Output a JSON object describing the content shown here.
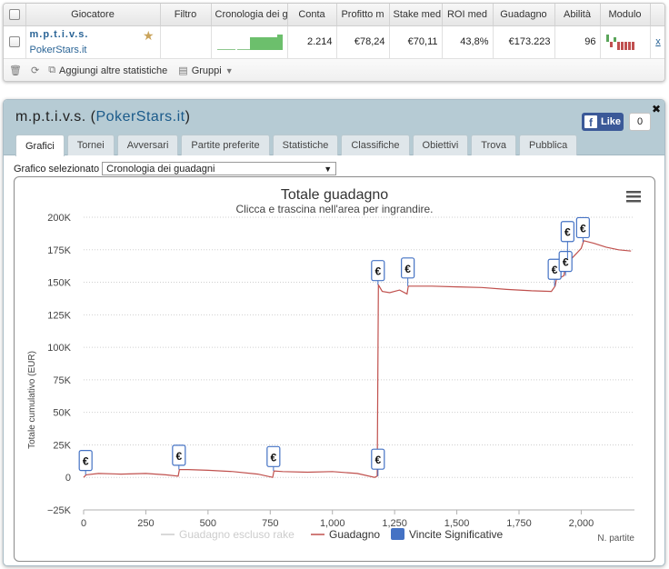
{
  "table": {
    "headers": [
      "Giocatore",
      "Filtro",
      "Cronologia dei g",
      "Conta",
      "Profitto m",
      "Stake med",
      "ROI med",
      "Guadagno",
      "Abilità",
      "Modulo"
    ],
    "row": {
      "player": "m.p.t.i.v.s.",
      "room": "PokerStars.it",
      "filter": "",
      "count": "2.214",
      "avg_profit": "€78,24",
      "avg_stake": "€70,11",
      "avg_roi": "43,8%",
      "winnings": "€173.223",
      "ability": "96",
      "remove": "x"
    },
    "toolbar": {
      "add_stats": "Aggiungi altre statistiche",
      "groups": "Gruppi"
    }
  },
  "panel": {
    "player": "m.p.t.i.v.s.",
    "site": "PokerStars.it",
    "like_label": "Like",
    "like_count": "0",
    "tabs": [
      "Grafici",
      "Tornei",
      "Avversari",
      "Partite preferite",
      "Statistiche",
      "Classifiche",
      "Obiettivi",
      "Trova",
      "Pubblica"
    ],
    "active_tab": "Grafici",
    "selector_label": "Grafico selezionato",
    "selected_chart": "Cronologia dei guadagni"
  },
  "chart_data": {
    "type": "line",
    "title": "Totale guadagno",
    "subtitle": "Clicca e trascina nell'area per ingrandire.",
    "xlabel": "N. partite",
    "ylabel": "Totale cumulativo (EUR)",
    "xlim": [
      0,
      2214
    ],
    "ylim": [
      -25000,
      200000
    ],
    "xticks": [
      0,
      250,
      500,
      750,
      1000,
      1250,
      1500,
      1750,
      2000
    ],
    "xtick_labels": [
      "0",
      "250",
      "500",
      "750",
      "1,000",
      "1,250",
      "1,500",
      "1,750",
      "2,000"
    ],
    "yticks": [
      -25000,
      0,
      25000,
      50000,
      75000,
      100000,
      125000,
      150000,
      175000,
      200000
    ],
    "ytick_labels": [
      "−25K",
      "0",
      "25K",
      "50K",
      "75K",
      "100K",
      "125K",
      "150K",
      "175K",
      "200K"
    ],
    "grid": "horizontal dotted",
    "legend_position": "bottom",
    "series": [
      {
        "name": "Guadagno escluso rake",
        "color": "#cccccc",
        "visible": false
      },
      {
        "name": "Guadagno",
        "color": "#c0504d",
        "x": [
          0,
          10,
          60,
          150,
          250,
          330,
          380,
          385,
          420,
          500,
          600,
          700,
          760,
          765,
          800,
          900,
          1000,
          1100,
          1170,
          1180,
          1185,
          1200,
          1230,
          1270,
          1300,
          1305,
          1400,
          1500,
          1600,
          1700,
          1800,
          1880,
          1895,
          1900,
          1930,
          1940,
          1960,
          1980,
          2000,
          2010,
          2050,
          2100,
          2150,
          2200
        ],
        "y": [
          0,
          2000,
          3000,
          2500,
          3000,
          2000,
          1000,
          6000,
          6000,
          5500,
          4500,
          2500,
          0,
          5000,
          4500,
          4000,
          4500,
          3000,
          0,
          1000,
          148000,
          143000,
          142000,
          144000,
          141000,
          147000,
          147000,
          146500,
          146000,
          144500,
          143500,
          143000,
          147000,
          152000,
          155000,
          165000,
          168000,
          172000,
          176000,
          182000,
          180000,
          177000,
          175000,
          174000
        ]
      },
      {
        "name": "Vincite Significative",
        "color": "#4472c4",
        "marker_label": "€",
        "points": [
          {
            "x": 8,
            "y": 2000,
            "flag_y": 13000
          },
          {
            "x": 383,
            "y": 6000,
            "flag_y": 17000
          },
          {
            "x": 763,
            "y": 5000,
            "flag_y": 16000
          },
          {
            "x": 1183,
            "y": 1000,
            "flag_y": 14000
          },
          {
            "x": 1183,
            "y": 148000,
            "flag_y": 159000
          },
          {
            "x": 1303,
            "y": 147000,
            "flag_y": 161000
          },
          {
            "x": 1893,
            "y": 147000,
            "flag_y": 160000
          },
          {
            "x": 1937,
            "y": 155000,
            "flag_y": 166000
          },
          {
            "x": 1945,
            "y": 168000,
            "flag_y": 189000
          },
          {
            "x": 2007,
            "y": 181000,
            "flag_y": 192000
          }
        ]
      }
    ]
  }
}
